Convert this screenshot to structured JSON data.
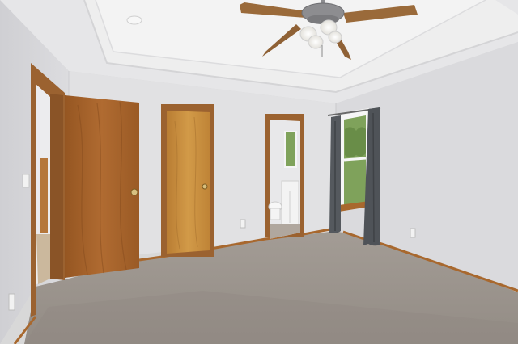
{
  "scene": {
    "subject": "",
    "palette": {
      "wall_left": "#dcdcdf",
      "wall_back": "#e1e1e3",
      "wall_right": "#dadadd",
      "ceiling": "#ececec",
      "ceiling_tray": "#f1f1f1",
      "carpet": "#9d968f",
      "carpet_dark": "#8e8881",
      "door_wood": "#a9652d",
      "door_wood_dark": "#8a4f21",
      "closet_door": "#c98f3e",
      "frame_wood": "#9b6230",
      "baseboard": "#a8682e",
      "curtain": "#55595e",
      "window_glass": "#7fa25b",
      "bath_wall": "#e8e8ea",
      "fan_blade": "#9a6a3a",
      "fan_metal": "#8d8d90",
      "light_glass": "#f6f4ee",
      "outlet": "#f2f2f2"
    }
  }
}
